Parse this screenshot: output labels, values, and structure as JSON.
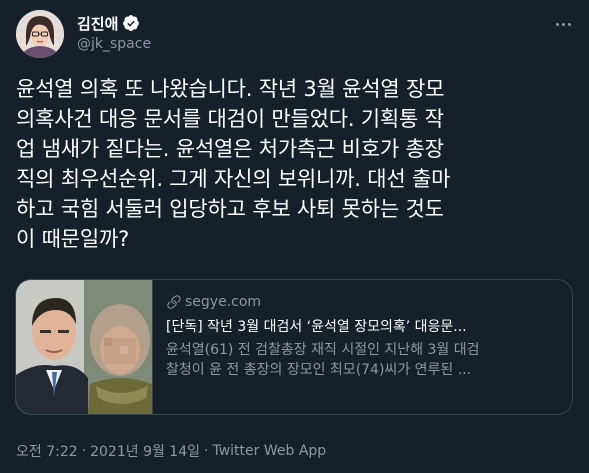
{
  "author": {
    "display_name": "김진애",
    "handle": "@jk_space",
    "verified_icon": "verified-badge-icon"
  },
  "tweet": {
    "text": "윤석열 의혹 또 나왔습니다. 작년 3월 윤석열 장모\n의혹사건 대응 문서를 대검이 만들었다. 기획통 작\n업 냄새가 짙다는. 윤석열은 처가측근 비호가  총장\n직의 최우선순위. 그게 자신의 보위니까. 대선 출마\n하고 국힘 서둘러 입당하고 후보 사퇴 못하는 것도\n이 때문일까?"
  },
  "card": {
    "domain": "segye.com",
    "title": "[단독] 작년 3월 대검서 ‘윤석열 장모의혹’ 대응문...",
    "desc_line1": "윤석열(61) 전 검찰총장 재직 시절인 지난해 3월 대검",
    "desc_line2": "찰청이 윤 전 총장의 장모인 최모(74)씨가 연루된 ..."
  },
  "meta": {
    "time": "오전 7:22",
    "separator": "·",
    "date": "2021년 9월 14일",
    "source": "Twitter Web App"
  },
  "colors": {
    "background": "#15202b",
    "text": "#ffffff",
    "muted": "#8b98a5",
    "border": "#38444d",
    "verified": "#ffffff"
  }
}
